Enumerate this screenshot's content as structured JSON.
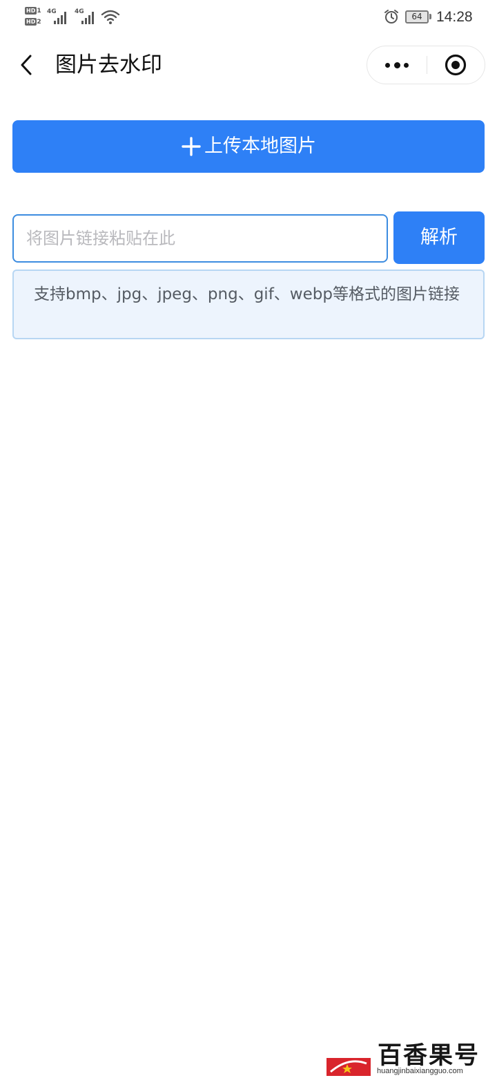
{
  "status_bar": {
    "hd1": "HD",
    "hd1_sub": "1",
    "hd2": "HD",
    "hd2_sub": "2",
    "net1": "4G",
    "net2": "4G",
    "battery": "64",
    "time": "14:28"
  },
  "nav": {
    "title": "图片去水印",
    "icons": {
      "back": "chevron-left-icon",
      "more": "more-dots-icon",
      "close": "target-circle-icon"
    }
  },
  "upload": {
    "label": "上传本地图片",
    "icon": "plus-icon"
  },
  "url_input": {
    "value": "",
    "placeholder": "将图片链接粘贴在此"
  },
  "parse_button": {
    "label": "解析"
  },
  "hint": {
    "text": "支持bmp、jpg、jpeg、png、gif、webp等格式的图片链接"
  },
  "watermark": {
    "name": "百香果号",
    "url": "huangjinbaixiangguo.com"
  },
  "colors": {
    "primary": "#2e80f6",
    "input_border": "#3c8ce0",
    "hint_bg": "#edf4fd",
    "hint_border": "#b7d6f3",
    "hint_text": "#555b63",
    "watermark_red": "#d9252c",
    "watermark_star": "#f5c518"
  }
}
